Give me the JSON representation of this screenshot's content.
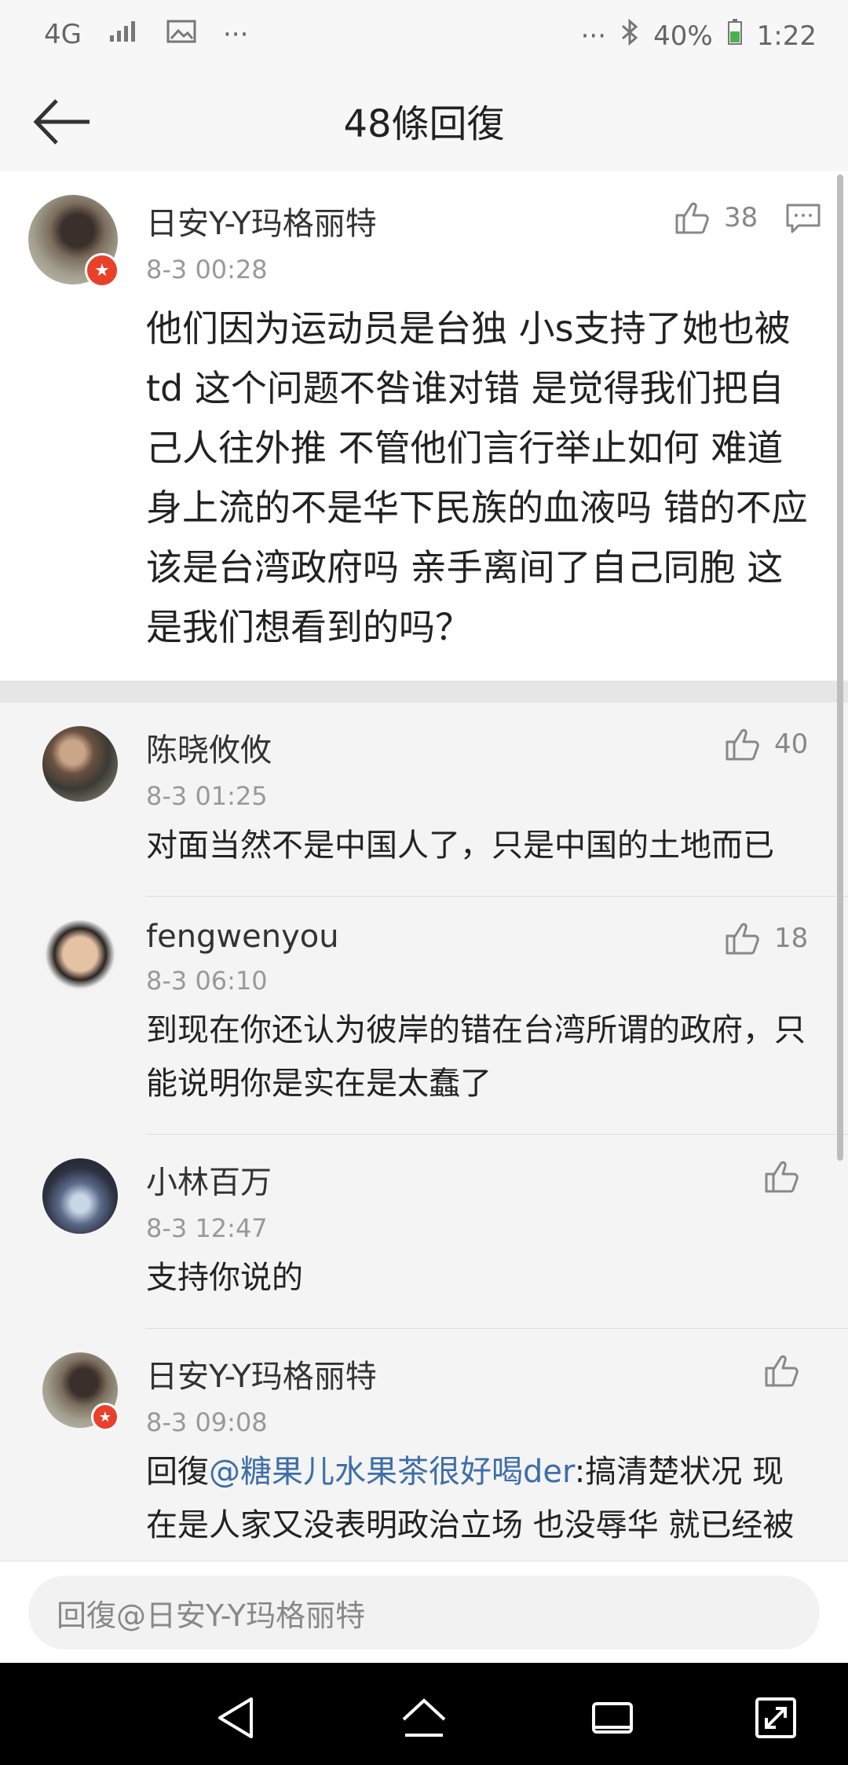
{
  "status": {
    "network": "4G",
    "more": "···",
    "more_right": "···",
    "battery": "40%",
    "time": "1:22"
  },
  "header": {
    "title": "48條回復"
  },
  "main_post": {
    "username": "日安Y-Y玛格丽特",
    "time": "8-3 00:28",
    "likes": "38",
    "text": "他们因为运动员是台独 小s支持了她也被td 这个问题不咎谁对错 是觉得我们把自己人往外推 不管他们言行举止如何 难道身上流的不是华下民族的血液吗 错的不应该是台湾政府吗 亲手离间了自己同胞 这是我们想看到的吗？"
  },
  "replies": [
    {
      "username": "陈晓攸攸",
      "time": "8-3 01:25",
      "likes": "40",
      "text": "对面当然不是中国人了，只是中国的土地而已"
    },
    {
      "username": "fengwenyou",
      "time": "8-3 06:10",
      "likes": "18",
      "text": "到现在你还认为彼岸的错在台湾所谓的政府，只能说明你是实在是太蠢了"
    },
    {
      "username": "小林百万",
      "time": "8-3 12:47",
      "likes": "",
      "text": "支持你说的"
    },
    {
      "username": "日安Y-Y玛格丽特",
      "time": "8-3 09:08",
      "likes": "",
      "text_prefix": "回復",
      "mention": "@糖果儿水果茶很好喝der",
      "text": ":搞清楚状况 现在是人家又没表明政治立场  也没辱华 就已经被我们接抵制了 这和对面的台独人有什么区别"
    }
  ],
  "input": {
    "placeholder": "回復@日安Y-Y玛格丽特"
  },
  "colors": {
    "link": "#3d6ea8",
    "badge": "#e8402a"
  }
}
